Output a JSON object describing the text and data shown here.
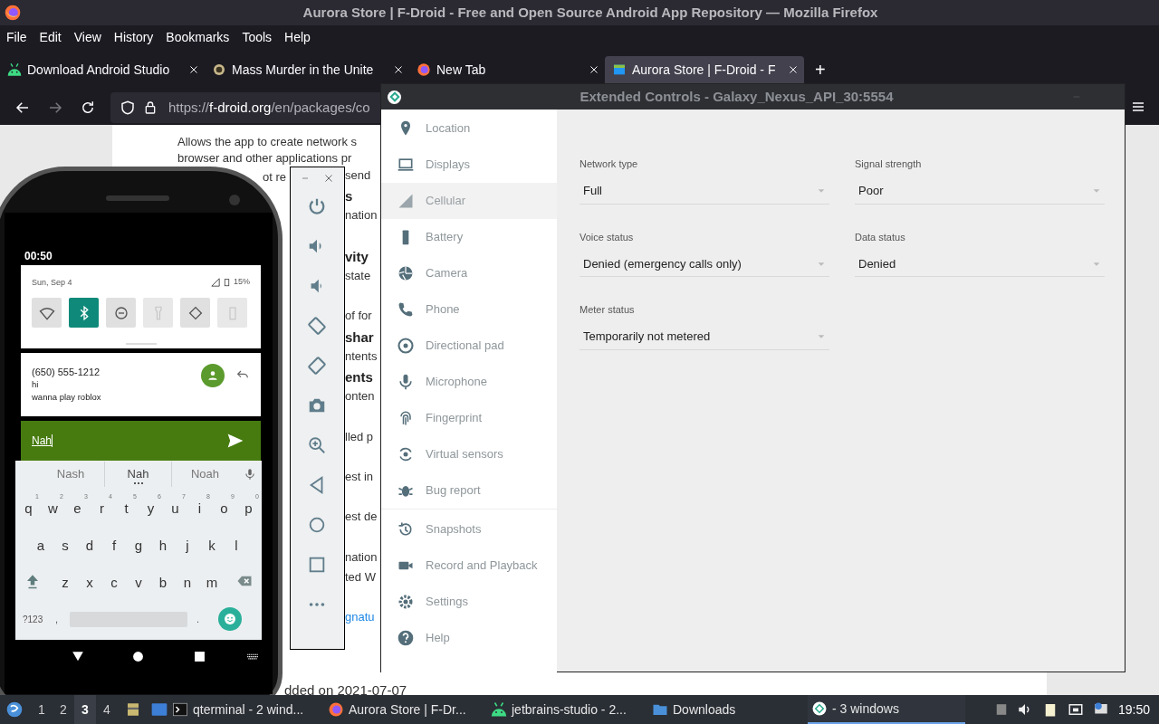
{
  "firefox": {
    "title": "Aurora Store | F-Droid - Free and Open Source Android App Repository — Mozilla Firefox",
    "menu": [
      "File",
      "Edit",
      "View",
      "History",
      "Bookmarks",
      "Tools",
      "Help"
    ],
    "tabs": [
      {
        "label": "Download Android Studio",
        "selected": false
      },
      {
        "label": "Mass Murder in the Unite",
        "selected": false
      },
      {
        "label": "New Tab",
        "selected": false
      },
      {
        "label": "Aurora Store | F-Droid - F",
        "selected": true
      }
    ],
    "new_tab": "+",
    "url": {
      "scheme": "https://",
      "host": "f-droid.org",
      "path": "/en/packages/co"
    },
    "page": {
      "lines": [
        "Allows the app to create network s",
        "browser and other applications pr"
      ],
      "left_fragment": "ot re",
      "right_fragments": [
        {
          "text": "send",
          "kind": "body"
        },
        {
          "text": "s",
          "kind": "heading"
        },
        {
          "text": "nation",
          "kind": "body"
        },
        {
          "text": "vity",
          "kind": "heading"
        },
        {
          "text": "state",
          "kind": "body"
        },
        {
          "text": "of for",
          "kind": "body"
        },
        {
          "text": "shar",
          "kind": "heading"
        },
        {
          "text": "ntents",
          "kind": "body"
        },
        {
          "text": "ents",
          "kind": "heading"
        },
        {
          "text": "onten",
          "kind": "body"
        },
        {
          "text": "lled p",
          "kind": "body"
        },
        {
          "text": "est in",
          "kind": "body"
        },
        {
          "text": "est de",
          "kind": "body"
        },
        {
          "text": "nation",
          "kind": "body"
        },
        {
          "text": "ted W",
          "kind": "body"
        },
        {
          "text": "gnatu",
          "kind": "link"
        }
      ],
      "footer": "dded on 2021-07-07"
    }
  },
  "phone": {
    "time": "00:50",
    "date": "Sun, Sep 4",
    "battery": "15%",
    "tiles": [
      {
        "kind": "wifi",
        "on": false,
        "disabled": false
      },
      {
        "kind": "bluetooth",
        "on": true,
        "disabled": false
      },
      {
        "kind": "dnd",
        "on": false,
        "disabled": false
      },
      {
        "kind": "flashlight",
        "on": false,
        "disabled": true
      },
      {
        "kind": "rotate",
        "on": false,
        "disabled": false
      },
      {
        "kind": "battery",
        "on": false,
        "disabled": true
      }
    ],
    "notification": {
      "sender": "(650) 555-1212",
      "lines": [
        "hi",
        "wanna play roblox"
      ]
    },
    "reply": {
      "value": "Nah"
    },
    "suggestions": [
      {
        "text": "Nash",
        "selected": false
      },
      {
        "text": "Nah",
        "selected": true
      },
      {
        "text": "Noah",
        "selected": false
      }
    ],
    "keys": [
      [
        {
          "text": "q",
          "hint": "1"
        },
        {
          "text": "w",
          "hint": "2"
        },
        {
          "text": "e",
          "hint": "3"
        },
        {
          "text": "r",
          "hint": "4"
        },
        {
          "text": "t",
          "hint": "5"
        },
        {
          "text": "y",
          "hint": "6"
        },
        {
          "text": "u",
          "hint": "7"
        },
        {
          "text": "i",
          "hint": "8"
        },
        {
          "text": "o",
          "hint": "9"
        },
        {
          "text": "p",
          "hint": "0"
        }
      ],
      [
        {
          "text": "a"
        },
        {
          "text": "s"
        },
        {
          "text": "d"
        },
        {
          "text": "f"
        },
        {
          "text": "g"
        },
        {
          "text": "h"
        },
        {
          "text": "j"
        },
        {
          "text": "k"
        },
        {
          "text": "l"
        }
      ],
      [
        {
          "text": "z"
        },
        {
          "text": "x"
        },
        {
          "text": "c"
        },
        {
          "text": "v"
        },
        {
          "text": "b"
        },
        {
          "text": "n"
        },
        {
          "text": "m"
        }
      ]
    ],
    "symbols_key": "?123",
    "comma_key": ",",
    "period_key": "."
  },
  "extended_controls": {
    "title": "Extended Controls - Galaxy_Nexus_API_30:5554",
    "sidebar": [
      [
        {
          "label": "Location",
          "selected": false
        },
        {
          "label": "Displays",
          "selected": false
        },
        {
          "label": "Cellular",
          "selected": true
        },
        {
          "label": "Battery",
          "selected": false
        },
        {
          "label": "Camera",
          "selected": false
        },
        {
          "label": "Phone",
          "selected": false
        },
        {
          "label": "Directional pad",
          "selected": false
        },
        {
          "label": "Microphone",
          "selected": false
        },
        {
          "label": "Fingerprint",
          "selected": false
        },
        {
          "label": "Virtual sensors",
          "selected": false
        },
        {
          "label": "Bug report",
          "selected": false
        }
      ],
      [
        {
          "label": "Snapshots",
          "selected": false
        },
        {
          "label": "Record and Playback",
          "selected": false
        },
        {
          "label": "Settings",
          "selected": false
        },
        {
          "label": "Help",
          "selected": false
        }
      ]
    ],
    "fields": [
      {
        "label": "Network type",
        "value": "Full"
      },
      {
        "label": "Signal strength",
        "value": "Poor"
      },
      {
        "label": "Voice status",
        "value": "Denied (emergency calls only)"
      },
      {
        "label": "Data status",
        "value": "Denied"
      },
      {
        "label": "Meter status",
        "value": "Temporarily not metered"
      }
    ]
  },
  "taskbar": {
    "workspaces": [
      {
        "label": "1",
        "selected": false
      },
      {
        "label": "2",
        "selected": false
      },
      {
        "label": "3",
        "selected": true
      },
      {
        "label": "4",
        "selected": false
      }
    ],
    "tasks": [
      {
        "label": "qterminal - 2 wind...",
        "kind": "terminal",
        "selected": false
      },
      {
        "label": "Aurora Store | F-Dr...",
        "kind": "firefox",
        "selected": false
      },
      {
        "label": "jetbrains-studio - 2...",
        "kind": "android",
        "selected": false
      },
      {
        "label": "Downloads",
        "kind": "folder",
        "selected": false
      },
      {
        "label": "- 3 windows",
        "kind": "emulator",
        "selected": true
      }
    ],
    "clock": "19:50"
  }
}
